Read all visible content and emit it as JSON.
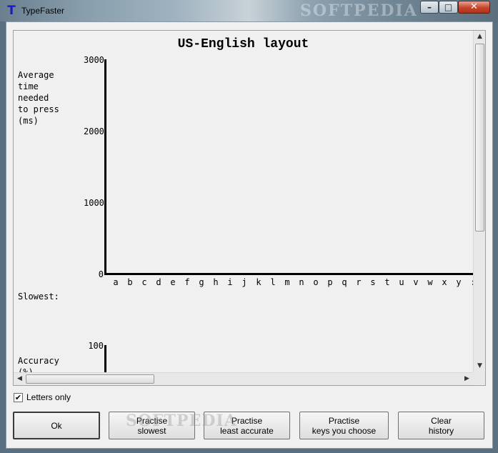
{
  "window": {
    "title": "TypeFaster",
    "app_icon_glyph": "T",
    "titlebar_watermark": "SOFTPEDIA",
    "controls": {
      "minimize": "–",
      "maximize": "□",
      "close": "✕"
    }
  },
  "chart_data": {
    "type": "bar",
    "title": "US-English layout",
    "ylabel_lines": [
      "Average",
      "time",
      "needed",
      "to press",
      "(ms)"
    ],
    "yticks": [
      "3000",
      "2000",
      "1000",
      "0"
    ],
    "ylim": [
      0,
      3000
    ],
    "categories": [
      "a",
      "b",
      "c",
      "d",
      "e",
      "f",
      "g",
      "h",
      "i",
      "j",
      "k",
      "l",
      "m",
      "n",
      "o",
      "p",
      "q",
      "r",
      "s",
      "t",
      "u",
      "v",
      "w",
      "x",
      "y",
      ":"
    ],
    "values": [],
    "grid": false
  },
  "sections": {
    "slowest_label": "Slowest:",
    "accuracy_label": "Accuracy",
    "accuracy_unit_partial": "(%)",
    "accuracy_top_tick": "100"
  },
  "options": {
    "letters_only_label": "Letters only",
    "letters_only_checked": true,
    "check_glyph": "✔"
  },
  "buttons": {
    "ok": "Ok",
    "practise_slowest": [
      "Practise",
      "slowest"
    ],
    "practise_least_accurate": [
      "Practise",
      "least accurate"
    ],
    "practise_keys_you_choose": [
      "Practise",
      "keys you choose"
    ],
    "clear_history": [
      "Clear",
      "history"
    ]
  },
  "icons": {
    "scroll_up": "▲",
    "scroll_down": "▼",
    "scroll_left": "◀",
    "scroll_right": "▶"
  },
  "watermark": "SOFTPEDIA"
}
